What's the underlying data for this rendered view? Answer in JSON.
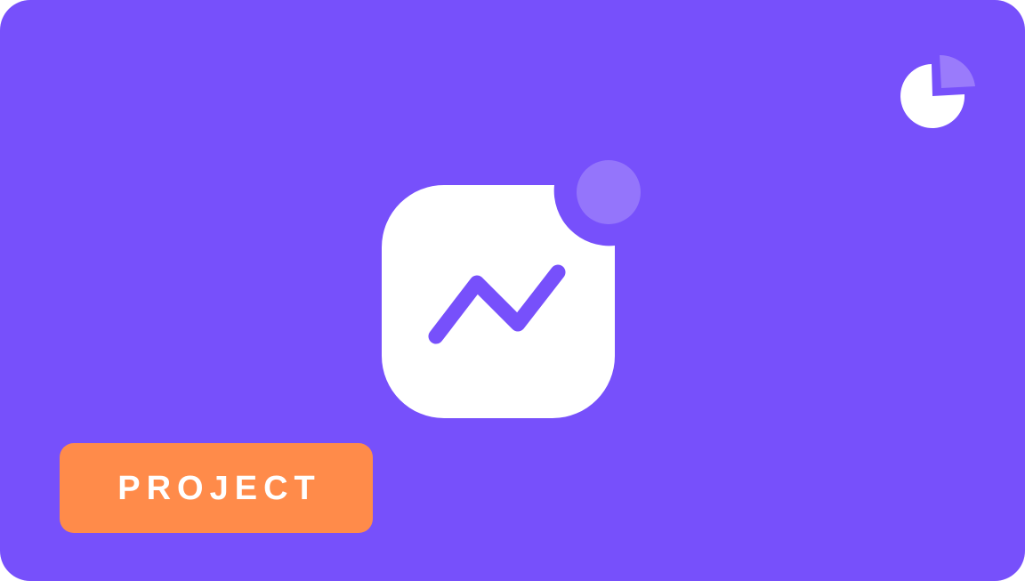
{
  "colors": {
    "background": "#7750fb",
    "icon_fill": "#ffffff",
    "dot_fill": "#9475fb",
    "pie_slice": "#9a7bfb",
    "badge_bg": "#ff8b4a",
    "badge_text": "#ffffff"
  },
  "icons": {
    "corner": "pie-chart-icon",
    "center": "trend-line-app-icon",
    "notification": "notification-dot"
  },
  "badge": {
    "label": "PROJECT"
  }
}
